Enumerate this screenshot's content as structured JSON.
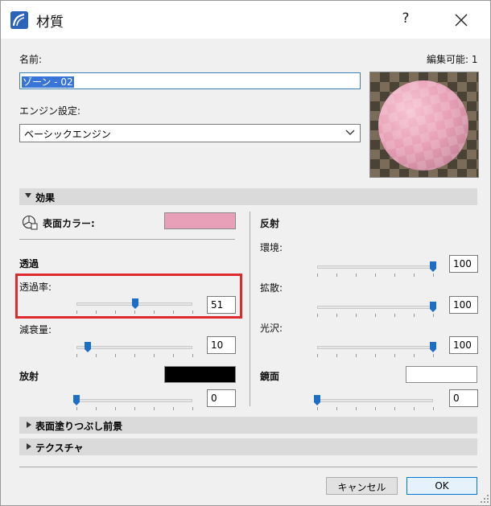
{
  "window": {
    "title": "材質",
    "help_label": "?"
  },
  "header": {
    "name_label": "名前:",
    "name_value": "ゾーン - 02",
    "editable_label": "編集可能: 1",
    "engine_label": "エンジン設定:",
    "engine_value": "ベーシックエンジン"
  },
  "effects": {
    "section_label": "効果",
    "surface_color_label": "表面カラー:",
    "surface_color": "#e7a0b8",
    "transparency_heading": "透過",
    "transparency_label": "透過率:",
    "transparency_value": "51",
    "attenuation_label": "減衰量:",
    "attenuation_value": "10",
    "emission_label": "放射",
    "emission_color": "#000000",
    "emission_value": "0",
    "reflection_heading": "反射",
    "ambient_label": "環境:",
    "ambient_value": "100",
    "diffuse_label": "拡散:",
    "diffuse_value": "100",
    "gloss_label": "光沢:",
    "gloss_value": "100",
    "specular_label": "鏡面",
    "specular_color": "#ffffff",
    "specular_value": "0"
  },
  "sections": {
    "fill_label": "表面塗りつぶし前景",
    "texture_label": "テクスチャ"
  },
  "buttons": {
    "cancel_label": "キャンセル",
    "ok_label": "OK"
  },
  "colors": {
    "highlight": "#e0282f",
    "selection": "#3875d7",
    "slider_thumb": "#1e6ec8"
  },
  "sliders": {
    "transparency": 0.51,
    "attenuation": 0.1,
    "emission": 0.0,
    "ambient": 1.0,
    "diffuse": 1.0,
    "gloss": 1.0,
    "specular": 0.0
  }
}
